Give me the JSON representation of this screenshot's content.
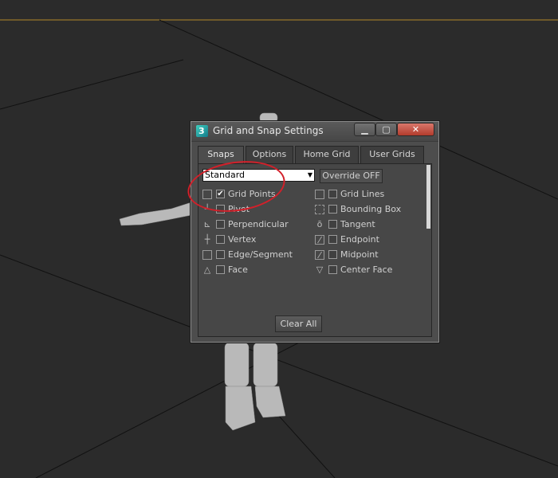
{
  "window": {
    "title": "Grid and Snap Settings",
    "controls": {
      "minimize": "▁",
      "maximize": "▢",
      "close": "✕"
    }
  },
  "tabs": [
    {
      "label": "Snaps",
      "active": true
    },
    {
      "label": "Options",
      "active": false
    },
    {
      "label": "Home Grid",
      "active": false
    },
    {
      "label": "User Grids",
      "active": false
    }
  ],
  "snaps": {
    "preset": "Standard",
    "override_label": "Override OFF",
    "left": [
      {
        "label": "Grid Points",
        "checked": true,
        "icon": "square-icon"
      },
      {
        "label": "Pivot",
        "checked": false,
        "icon": "pivot-icon"
      },
      {
        "label": "Perpendicular",
        "checked": false,
        "icon": "perpendicular-icon"
      },
      {
        "label": "Vertex",
        "checked": false,
        "icon": "vertex-icon"
      },
      {
        "label": "Edge/Segment",
        "checked": false,
        "icon": "square-icon"
      },
      {
        "label": "Face",
        "checked": false,
        "icon": "triangle-icon"
      }
    ],
    "right": [
      {
        "label": "Grid Lines",
        "checked": false,
        "icon": "square-icon"
      },
      {
        "label": "Bounding Box",
        "checked": false,
        "icon": "bounding-box-icon"
      },
      {
        "label": "Tangent",
        "checked": false,
        "icon": "tangent-icon"
      },
      {
        "label": "Endpoint",
        "checked": false,
        "icon": "endpoint-icon"
      },
      {
        "label": "Midpoint",
        "checked": false,
        "icon": "midpoint-icon"
      },
      {
        "label": "Center Face",
        "checked": false,
        "icon": "center-face-icon"
      }
    ],
    "clear_all_label": "Clear All"
  },
  "colors": {
    "viewport_bg": "#2b2b2b",
    "dialog_bg": "#4d4d4d",
    "highlight": "#d2202a",
    "horizon": "#b38a2a"
  }
}
